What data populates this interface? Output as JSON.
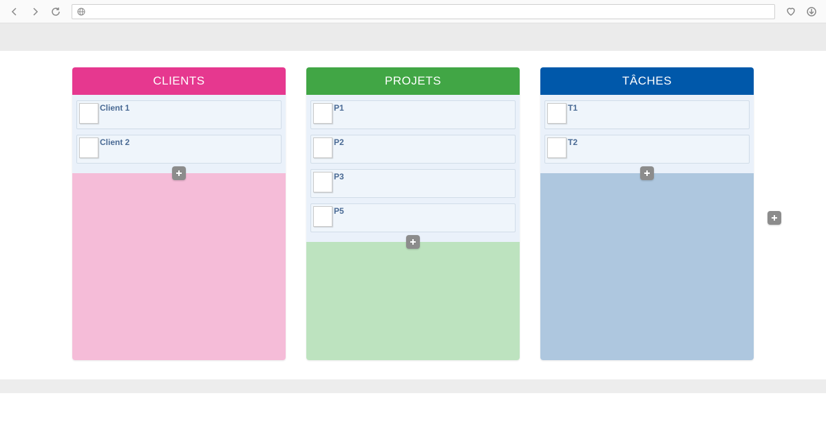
{
  "browser": {
    "url": ""
  },
  "columns": [
    {
      "key": "clients",
      "title": "CLIENTS",
      "items": [
        {
          "label": "Client 1"
        },
        {
          "label": "Client 2"
        }
      ]
    },
    {
      "key": "projets",
      "title": "PROJETS",
      "items": [
        {
          "label": "P1"
        },
        {
          "label": "P2"
        },
        {
          "label": "P3"
        },
        {
          "label": "P5"
        }
      ]
    },
    {
      "key": "taches",
      "title": "TÂCHES",
      "items": [
        {
          "label": "T1"
        },
        {
          "label": "T2"
        }
      ]
    }
  ]
}
